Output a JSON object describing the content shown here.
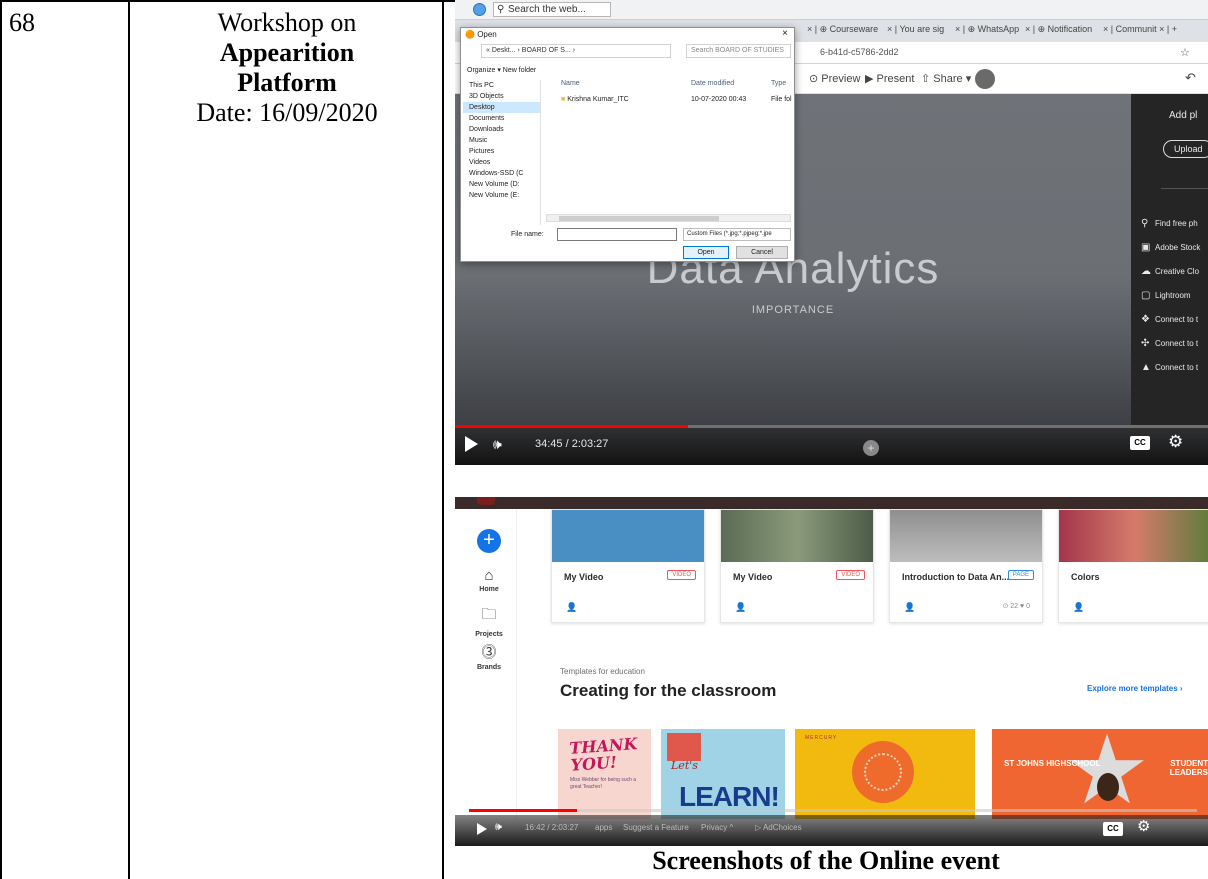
{
  "row": {
    "serial": "68",
    "event_line1": "Workshop on",
    "event_bold1": "Appearition",
    "event_bold2": "Platform",
    "event_date": "Date: 16/09/2020"
  },
  "caption": "Screenshots of the Online event",
  "shot1": {
    "taskbar_search": "Search the web...",
    "tabs": [
      "Courseware",
      "You are sig",
      "WhatsApp",
      "Notification",
      "Communit"
    ],
    "address": "6-b41d-c5786-2dd2",
    "appbar": {
      "preview": "Preview",
      "present": "Present",
      "share": "Share"
    },
    "slide": {
      "title": "Data Analytics",
      "subtitle": "IMPORTANCE"
    },
    "panel": {
      "add": "Add pl",
      "upload": "Upload",
      "items": [
        "Find free ph",
        "Adobe Stock",
        "Creative Clo",
        "Lightroom",
        "Connect to t",
        "Connect to t",
        "Connect to t"
      ]
    },
    "player": {
      "time": "34:45 / 2:03:27",
      "progress_fraction": 0.31
    },
    "dialog": {
      "title": "Open",
      "path": "« Deskt... › BOARD OF S... ›",
      "search": "Search BOARD OF STUDIES",
      "toolbar": "Organize ▾    New folder",
      "nav": [
        "This PC",
        "3D Objects",
        "Desktop",
        "Documents",
        "Downloads",
        "Music",
        "Pictures",
        "Videos",
        "Windows-SSD (C",
        "New Volume (D:",
        "New Volume (E:"
      ],
      "col_name": "Name",
      "col_date": "Date modified",
      "col_type": "Type",
      "file_name": "Krishna Kumar_ITC",
      "file_date": "10-07-2020 00:43",
      "file_type": "File fol",
      "file_name_label": "File name:",
      "filter": "Custom Files (*.jpg;*.pjpeg;*.jpe",
      "open": "Open",
      "cancel": "Cancel"
    }
  },
  "shot2": {
    "nav": {
      "home": "Home",
      "projects": "Projects",
      "brands": "Brands"
    },
    "cards": [
      {
        "title": "My Video",
        "badge": "VIDEO"
      },
      {
        "title": "My Video",
        "badge": "VIDEO"
      },
      {
        "title": "Introduction to Data An...",
        "badge": "PAGE",
        "stats": "⊙ 22   ♥ 0"
      },
      {
        "title": "Colors",
        "badge": ""
      }
    ],
    "small_label": "Templates for education",
    "heading": "Creating for the classroom",
    "explore": "Explore more templates ›",
    "templates": {
      "thank": "THANK YOU!",
      "thank_sub": "Miss Webber for being such a great Teacher!",
      "lets": "Let's",
      "learn": "LEARN!",
      "mercury": "MERCURY",
      "school_left": "ST JOHNS HIGHSCHOOL",
      "school_right": "STUDENT LEADERS"
    },
    "player": {
      "time": "16:42 / 2:03:27",
      "progress_fraction": 0.14
    },
    "footer": [
      "apps",
      "Suggest a Feature",
      "Privacy ^",
      "AdChoices"
    ]
  }
}
